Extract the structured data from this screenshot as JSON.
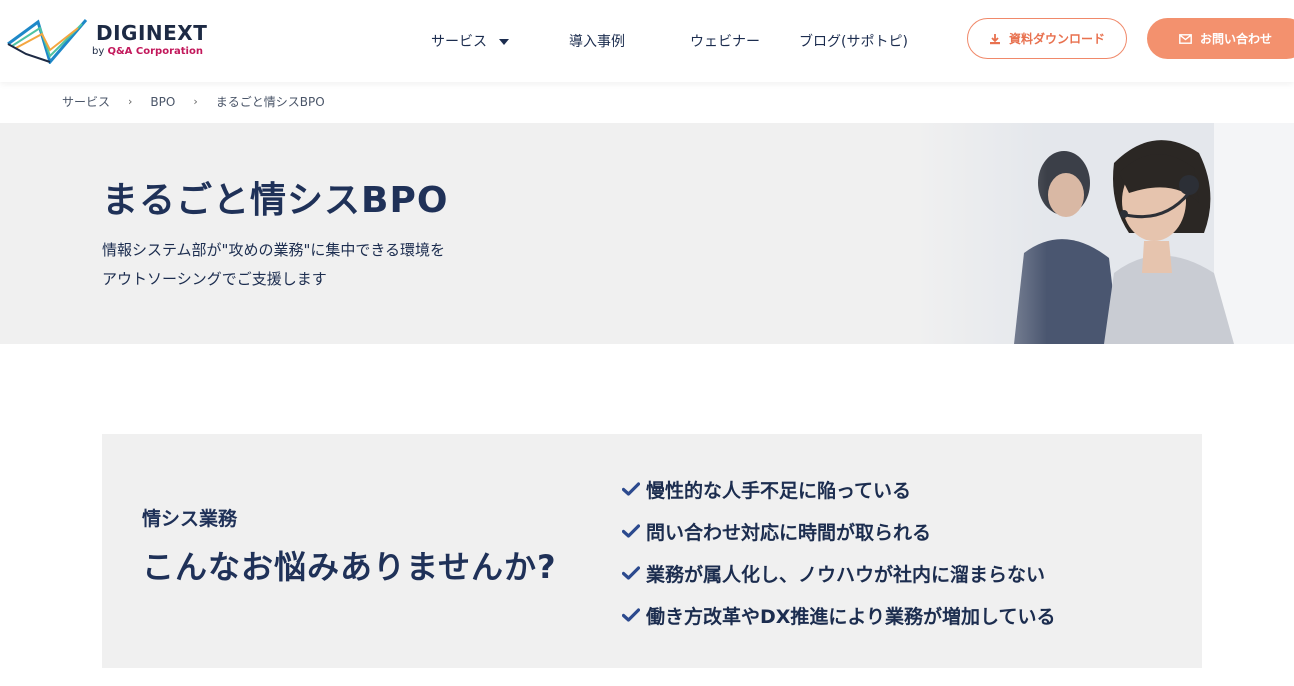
{
  "brand": {
    "name": "DIGINEXT",
    "sub_prefix": "by ",
    "sub_company": "Q&A Corporation"
  },
  "nav": {
    "items": [
      {
        "label": "サービス",
        "dropdown": true
      },
      {
        "label": "導入事例"
      },
      {
        "label": "ウェビナー"
      },
      {
        "label": "ブログ(サポトピ)"
      }
    ],
    "download_label": "資料ダウンロード",
    "contact_label": "お問い合わせ"
  },
  "breadcrumb": [
    "サービス",
    "BPO",
    "まるごと情シスBPO"
  ],
  "hero": {
    "title": "まるごと情シスBPO",
    "desc_line1": "情報システム部が\"攻めの業務\"に集中できる環境を",
    "desc_line2": "アウトソーシングでご支援します"
  },
  "problems": {
    "kicker": "情シス業務",
    "heading": "こんなお悩みありませんか?",
    "items": [
      "慢性的な人手不足に陥っている",
      "問い合わせ対応に時間が取られる",
      "業務が属人化し、ノウハウが社内に溜まらない",
      "働き方改革やDX推進により業務が増加している"
    ]
  },
  "colors": {
    "navy": "#1f3158",
    "accent": "#f3916e",
    "check": "#2c4a8e",
    "panel": "#f0f0f0"
  },
  "icons": [
    "download-icon",
    "mail-icon",
    "check-icon",
    "chevron-right-icon",
    "caret-down-icon"
  ]
}
